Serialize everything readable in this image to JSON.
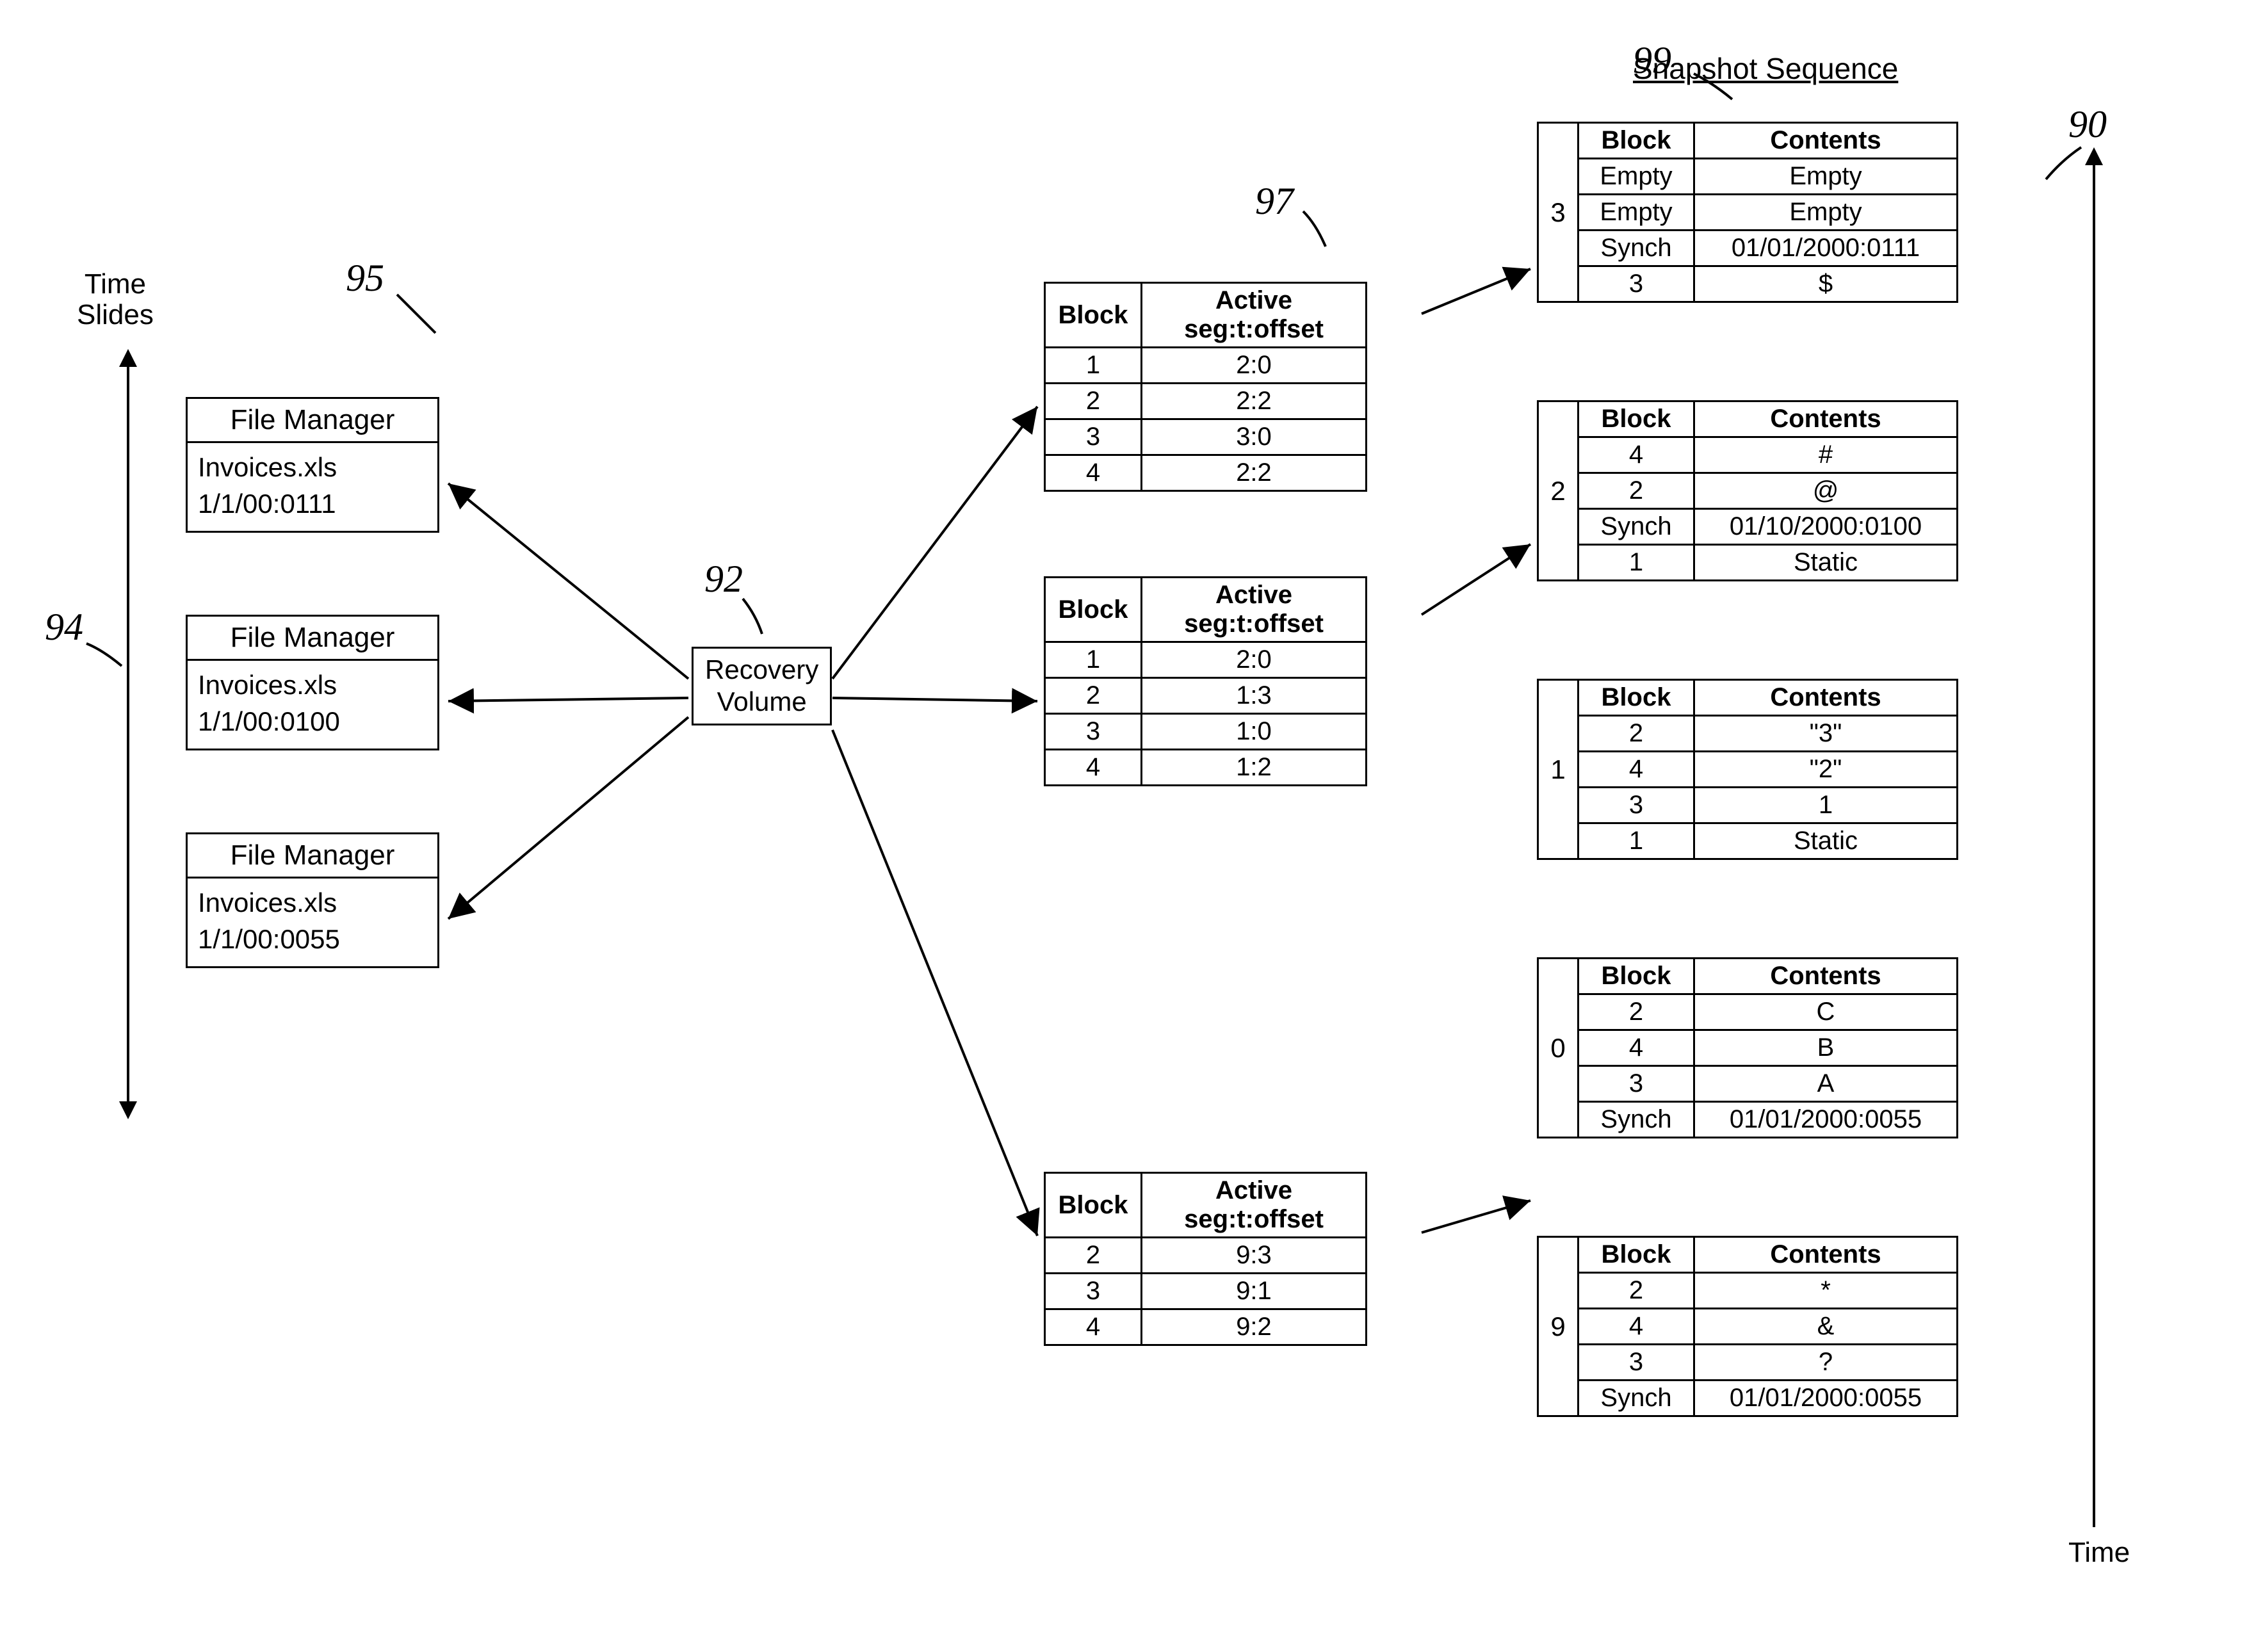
{
  "misc": {
    "snapshot_title": "Snapshot Sequence",
    "time_slides_label": "Time\nSlides",
    "time_label": "Time",
    "recovery_volume": "Recovery\nVolume"
  },
  "ref_nums": {
    "r90": "90",
    "r92": "92",
    "r94": "94",
    "r95": "95",
    "r97": "97",
    "r99": "99"
  },
  "file_managers": [
    {
      "title": "File Manager",
      "file": "Invoices.xls",
      "ts": "1/1/00:0111"
    },
    {
      "title": "File Manager",
      "file": "Invoices.xls",
      "ts": "1/1/00:0100"
    },
    {
      "title": "File Manager",
      "file": "Invoices.xls",
      "ts": "1/1/00:0055"
    }
  ],
  "seg_header": {
    "c1": "Block",
    "c2": "Active seg:t:offset"
  },
  "seg_tables": [
    {
      "rows": [
        [
          "1",
          "2:0"
        ],
        [
          "2",
          "2:2"
        ],
        [
          "3",
          "3:0"
        ],
        [
          "4",
          "2:2"
        ]
      ]
    },
    {
      "rows": [
        [
          "1",
          "2:0"
        ],
        [
          "2",
          "1:3"
        ],
        [
          "3",
          "1:0"
        ],
        [
          "4",
          "1:2"
        ]
      ]
    },
    {
      "rows": [
        [
          "2",
          "9:3"
        ],
        [
          "3",
          "9:1"
        ],
        [
          "4",
          "9:2"
        ]
      ]
    }
  ],
  "snap_header": {
    "c1": "Block",
    "c2": "Contents"
  },
  "snapshots": [
    {
      "idx": "3",
      "rows": [
        [
          "Empty",
          "Empty"
        ],
        [
          "Empty",
          "Empty"
        ],
        [
          "Synch",
          "01/01/2000:0111"
        ],
        [
          "3",
          "$"
        ]
      ]
    },
    {
      "idx": "2",
      "rows": [
        [
          "4",
          "#"
        ],
        [
          "2",
          "@"
        ],
        [
          "Synch",
          "01/10/2000:0100"
        ],
        [
          "1",
          "Static"
        ]
      ]
    },
    {
      "idx": "1",
      "rows": [
        [
          "2",
          "\"3\""
        ],
        [
          "4",
          "\"2\""
        ],
        [
          "3",
          "1"
        ],
        [
          "1",
          "Static"
        ]
      ]
    },
    {
      "idx": "0",
      "rows": [
        [
          "2",
          "C"
        ],
        [
          "4",
          "B"
        ],
        [
          "3",
          "A"
        ],
        [
          "Synch",
          "01/01/2000:0055"
        ]
      ]
    },
    {
      "idx": "9",
      "rows": [
        [
          "2",
          "*"
        ],
        [
          "4",
          "&"
        ],
        [
          "3",
          "?"
        ],
        [
          "Synch",
          "01/01/2000:0055"
        ]
      ]
    }
  ]
}
